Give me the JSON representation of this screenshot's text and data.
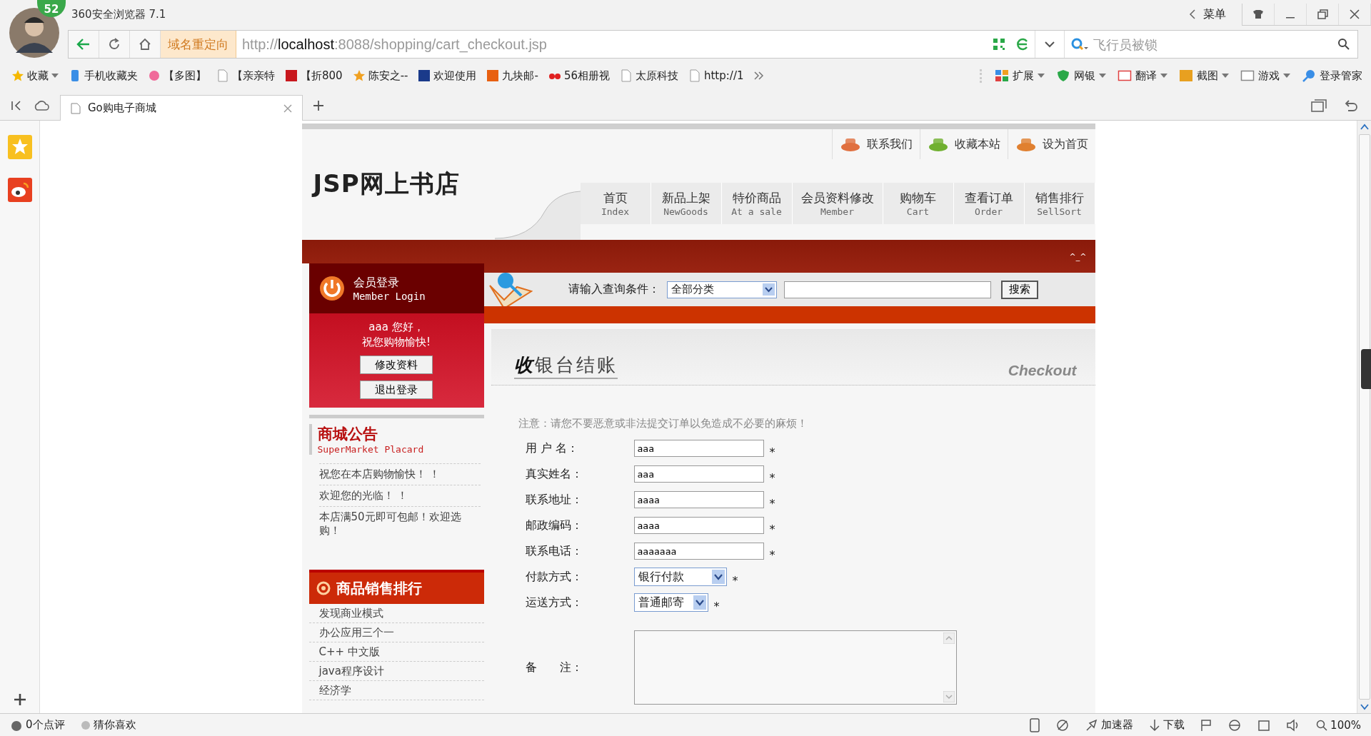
{
  "browser": {
    "title": "360安全浏览器 7.1",
    "badge": "52",
    "menu": "菜单",
    "redirect_label": "域名重定向",
    "url_scheme": "http://",
    "url_host": "localhost",
    "url_rest": ":8088/shopping/cart_checkout.jsp",
    "search_placeholder": "飞行员被锁"
  },
  "bookmarks": [
    {
      "label": "收藏",
      "dropdown": true
    },
    {
      "label": "手机收藏夹",
      "dropdown": false
    },
    {
      "label": "【多图】",
      "dropdown": false
    },
    {
      "label": "【亲亲特",
      "dropdown": false
    },
    {
      "label": "【折800",
      "dropdown": false
    },
    {
      "label": "陈安之--",
      "dropdown": false
    },
    {
      "label": "欢迎使用",
      "dropdown": false
    },
    {
      "label": "九块邮-",
      "dropdown": false
    },
    {
      "label": "56相册视",
      "dropdown": false
    },
    {
      "label": "太原科技",
      "dropdown": false
    },
    {
      "label": "http://1",
      "dropdown": false
    }
  ],
  "tools": [
    {
      "label": "扩展",
      "dropdown": true
    },
    {
      "label": "网银",
      "dropdown": true
    },
    {
      "label": "翻译",
      "dropdown": true
    },
    {
      "label": "截图",
      "dropdown": true
    },
    {
      "label": "游戏",
      "dropdown": true
    },
    {
      "label": "登录管家",
      "dropdown": false
    }
  ],
  "tabs": [
    {
      "title": "Go购电子商城",
      "selected": true
    }
  ],
  "store": {
    "top_links": [
      "联系我们",
      "收藏本站",
      "设为首页"
    ],
    "logo": "JSP网上书店",
    "nav": [
      {
        "zh": "首页",
        "en": "Index"
      },
      {
        "zh": "新品上架",
        "en": "NewGoods"
      },
      {
        "zh": "特价商品",
        "en": "At a sale"
      },
      {
        "zh": "会员资料修改",
        "en": "Member"
      },
      {
        "zh": "购物车",
        "en": "Cart"
      },
      {
        "zh": "查看订单",
        "en": "Order"
      },
      {
        "zh": "销售排行",
        "en": "SellSort"
      }
    ],
    "corner_mark": "^_^",
    "login": {
      "title": "会员登录",
      "subtitle": "Member Login",
      "greeting_user": "aaa 您好，",
      "greeting": "祝您购物愉快!",
      "buttons": [
        "修改资料",
        "退出登录"
      ]
    },
    "search": {
      "label": "请输入查询条件：",
      "category": "全部分类",
      "button": "搜索"
    },
    "placard": {
      "title": "商城公告",
      "subtitle": "SuperMarket Placard",
      "items": [
        "祝您在本店购物愉快！ ！",
        "欢迎您的光临！ ！",
        "本店满50元即可包邮！欢迎选购！"
      ]
    },
    "ranking": {
      "title": "商品销售排行",
      "items": [
        "发现商业模式",
        "办公应用三个一",
        "C++ 中文版",
        "java程序设计",
        "经济学"
      ]
    },
    "checkout": {
      "title": "**收**银台结账",
      "title_en": "Checkout",
      "notice": "注意：请您不要恶意或非法提交订单以免造成不必要的麻烦！",
      "fields": [
        {
          "kind": "text",
          "label": "用 户 名：",
          "value": "aaa",
          "mark": "*"
        },
        {
          "kind": "text",
          "label": "真实姓名：",
          "value": "aaa",
          "mark": "*"
        },
        {
          "kind": "text",
          "label": "联系地址：",
          "value": "aaaa",
          "mark": "*"
        },
        {
          "kind": "text",
          "label": "邮政编码：",
          "value": "aaaa",
          "mark": "*"
        },
        {
          "kind": "text",
          "label": "联系电话：",
          "value": "aaaaaaa",
          "mark": "*"
        },
        {
          "kind": "select",
          "label": "付款方式：",
          "value": "银行付款",
          "mark": "*"
        },
        {
          "kind": "select",
          "label": "运送方式：",
          "value": "普通邮寄",
          "mark": "*"
        },
        {
          "kind": "textarea",
          "label": "备　　注："
        }
      ]
    }
  },
  "status_bar": {
    "left": [
      "0个点评",
      "猜你喜欢"
    ],
    "right": [
      "加速器",
      "下载"
    ],
    "zoom": "100%"
  }
}
